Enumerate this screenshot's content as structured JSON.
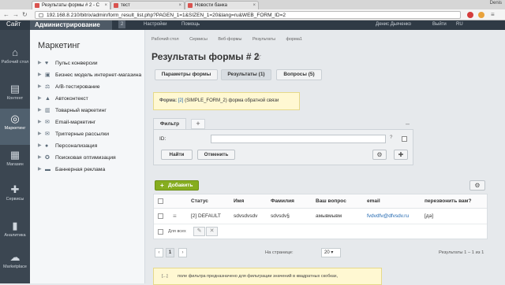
{
  "browser": {
    "tabs": [
      {
        "label": "Результаты формы # 2 - C"
      },
      {
        "label": "тест"
      },
      {
        "label": "Новости банка"
      }
    ],
    "user": "Denis",
    "url": "192.168.8.210/bitrix/admin/form_result_list.php?PAGEN_1=1&SIZEN_1=20&lang=ru&WEB_FORM_ID=2"
  },
  "topbar": {
    "site": "Сайт",
    "admin": "Администрирование",
    "badge": "2",
    "settings": "Настройки",
    "help": "Помощь",
    "user": "Денис Дьяченко",
    "logout": "Выйти",
    "lang": "RU"
  },
  "rail": [
    {
      "icon": "desktop-icon",
      "glyph": "⌂",
      "label": "Рабочий стол"
    },
    {
      "icon": "content-icon",
      "glyph": "▤",
      "label": "Контент"
    },
    {
      "icon": "marketing-icon",
      "glyph": "◎",
      "label": "Маркетинг"
    },
    {
      "icon": "shop-icon",
      "glyph": "▦",
      "label": "Магазин"
    },
    {
      "icon": "services-icon",
      "glyph": "✚",
      "label": "Сервисы"
    },
    {
      "icon": "analytics-icon",
      "glyph": "▮",
      "label": "Аналитика"
    },
    {
      "icon": "marketplace-icon",
      "glyph": "☁",
      "label": "Marketplace"
    }
  ],
  "sidebar": {
    "title": "Маркетинг",
    "items": [
      {
        "label": "Пульс конверсии",
        "glyph": "♥"
      },
      {
        "label": "Бизнес модель интернет-магазина",
        "glyph": "▣"
      },
      {
        "label": "A/B-тестирование",
        "glyph": "⚖"
      },
      {
        "label": "Автоконтекст",
        "glyph": "▲"
      },
      {
        "label": "Товарный маркетинг",
        "glyph": "▥"
      },
      {
        "label": "Email-маркетинг",
        "glyph": "✉"
      },
      {
        "label": "Триггерные рассылки",
        "glyph": "✉"
      },
      {
        "label": "Персонализация",
        "glyph": "●"
      },
      {
        "label": "Поисковая оптимизация",
        "glyph": "✪"
      },
      {
        "label": "Баннерная реклама",
        "glyph": "▬"
      }
    ]
  },
  "main": {
    "crumbs": [
      "Рабочий стол",
      "Сервисы",
      "Веб-формы",
      "Результаты",
      "форма1"
    ],
    "title": "Результаты формы # 2",
    "tabs": {
      "params": "Параметры формы",
      "results": "Результаты (1)",
      "questions": "Вопросы (5)"
    },
    "note": {
      "label": "Форма:",
      "id": "[2]",
      "text": "(SIMPLE_FORM_2) форма обратной связи"
    },
    "filter": {
      "tab": "Фильтр",
      "id_label": "ID:",
      "id_value": "",
      "help": "?",
      "find": "Найти",
      "cancel": "Отменить"
    },
    "add": "Добавить",
    "grid": {
      "headers": [
        "Статус",
        "Имя",
        "Фамилия",
        "Ваш вопрос",
        "email",
        "перезвонить вам?"
      ],
      "rows": [
        {
          "status": "[2] DEFAULT",
          "name": "sdvsdvsdv",
          "surname": "sdvsdv§",
          "question": "амывмывм",
          "email": "fvdvdfv@dfvsdv.ru",
          "callback": "[да]"
        }
      ],
      "for_all": "Для всех"
    },
    "pager": {
      "page": "1",
      "per_page_label": "На странице:",
      "per_page": "20",
      "results": "Результаты 1 – 1 из 1"
    },
    "bottom_note": {
      "tag": "[...]",
      "text": "поле фильтра предназначено для фильтрации значений в квадратных скобках,"
    }
  }
}
